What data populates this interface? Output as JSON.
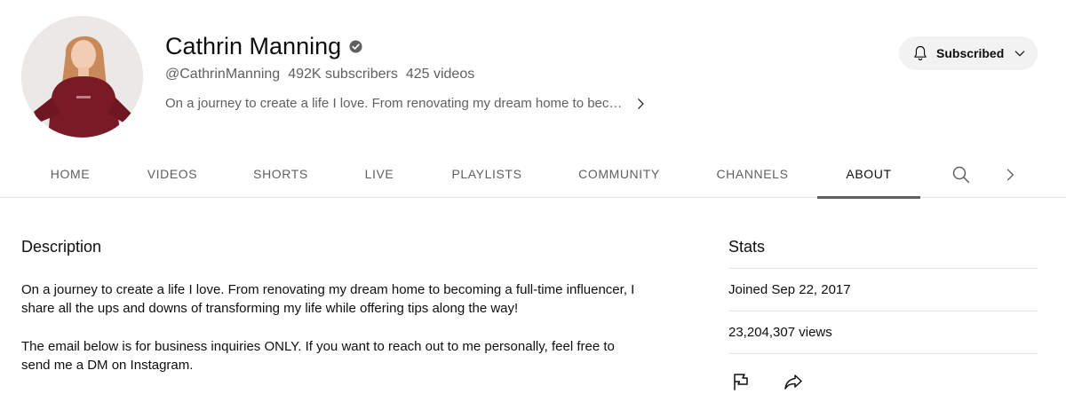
{
  "channel": {
    "name": "Cathrin Manning",
    "handle": "@CathrinManning",
    "subscribers": "492K subscribers",
    "videos": "425 videos",
    "short_description": "On a journey to create a life I love. From renovating my dream home to bec…"
  },
  "subscribe_button": {
    "label": "Subscribed",
    "icon": "bell-icon"
  },
  "tabs": [
    {
      "label": "HOME"
    },
    {
      "label": "VIDEOS"
    },
    {
      "label": "SHORTS"
    },
    {
      "label": "LIVE"
    },
    {
      "label": "PLAYLISTS"
    },
    {
      "label": "COMMUNITY"
    },
    {
      "label": "CHANNELS"
    },
    {
      "label": "ABOUT",
      "active": true
    }
  ],
  "description": {
    "heading": "Description",
    "paragraphs": [
      "On a journey to create a life I love. From renovating my dream home to becoming a full-time influencer, I share all the ups and downs of transforming my life while offering tips along the way!",
      "The email below is for business inquiries ONLY. If you want to reach out to me personally, feel free to send me a DM on Instagram."
    ]
  },
  "stats": {
    "heading": "Stats",
    "joined": "Joined Sep 22, 2017",
    "views": "23,204,307 views"
  },
  "colors": {
    "text_primary": "#0f0f0f",
    "text_secondary": "#606060",
    "button_bg": "#f2f2f2",
    "divider": "#e5e5e5",
    "sweater": "#7a1a27"
  }
}
